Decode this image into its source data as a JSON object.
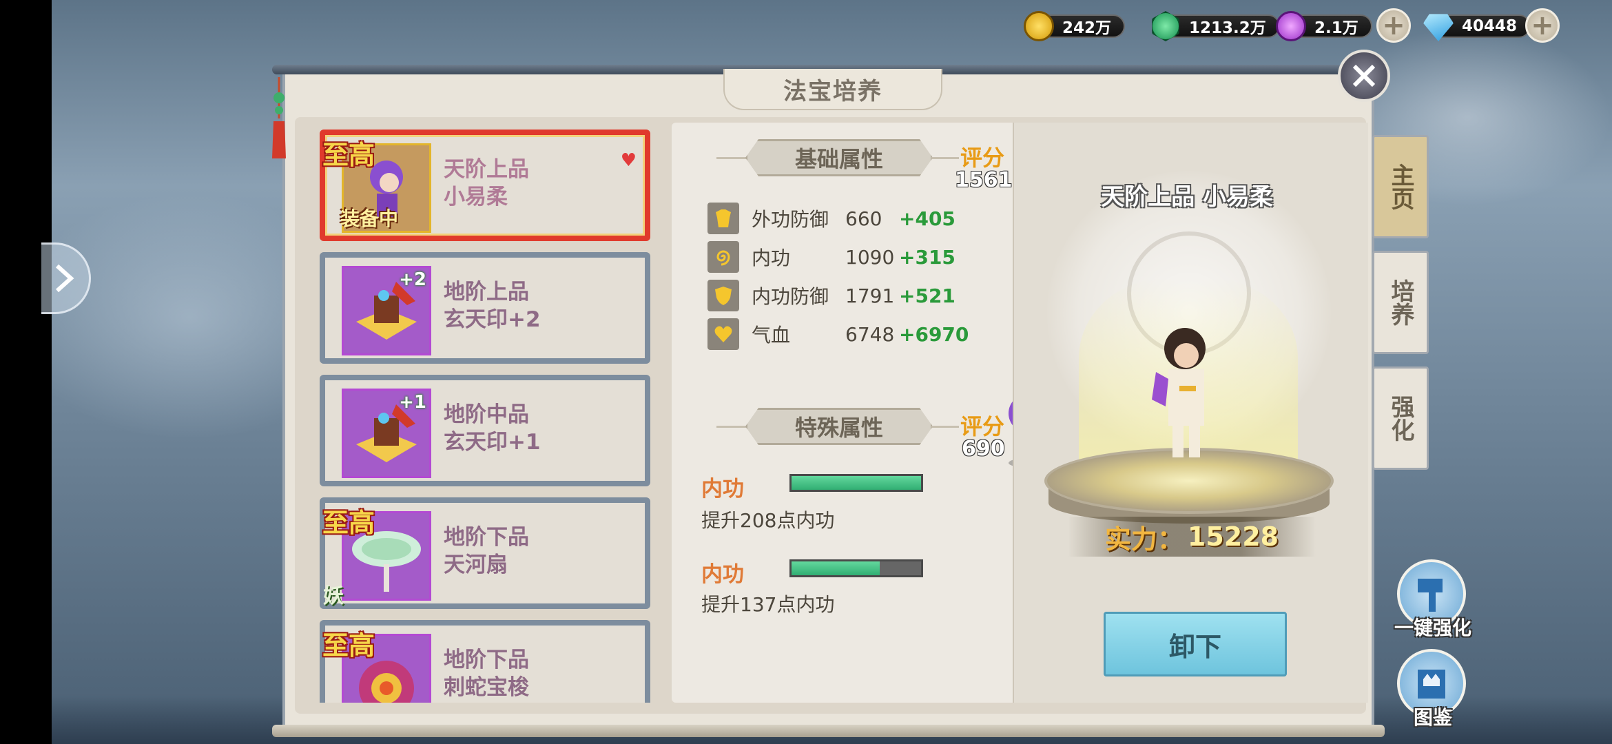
{
  "resources": [
    {
      "name": "gold",
      "value": "242万",
      "color": "#f2c81a",
      "icon": "gold-coin-icon"
    },
    {
      "name": "jade",
      "value": "1213.2万",
      "color": "#29b26a",
      "icon": "jade-gem-icon"
    },
    {
      "name": "spirit",
      "value": "2.1万",
      "color": "#b04ad8",
      "icon": "spirit-orb-icon"
    },
    {
      "name": "diamond",
      "value": "40448",
      "color": "#44b6f0",
      "icon": "diamond-icon"
    }
  ],
  "window": {
    "title": "法宝培养"
  },
  "items": [
    {
      "badge": "至高",
      "grade": "天阶上品",
      "name": "小易柔",
      "tag": "装备中",
      "plus": "",
      "selected": true
    },
    {
      "badge": "",
      "grade": "地阶上品",
      "name": "玄天印+2",
      "tag": "",
      "plus": "+2",
      "selected": false
    },
    {
      "badge": "",
      "grade": "地阶中品",
      "name": "玄天印+1",
      "tag": "",
      "plus": "+1",
      "selected": false
    },
    {
      "badge": "至高",
      "grade": "地阶下品",
      "name": "天河扇",
      "tag": "",
      "plus": "",
      "yao": "妖",
      "selected": false
    },
    {
      "badge": "至高",
      "grade": "地阶下品",
      "name": "刺蛇宝梭",
      "tag": "",
      "plus": "",
      "selected": false
    }
  ],
  "basic": {
    "header": "基础属性",
    "score_label": "评分",
    "score": "1561",
    "stats": [
      {
        "name": "外功防御",
        "value": "660",
        "add": "+405",
        "icon": "armor-icon"
      },
      {
        "name": "内功",
        "value": "1090",
        "add": "+315",
        "icon": "spiral-icon"
      },
      {
        "name": "内功防御",
        "value": "1791",
        "add": "+521",
        "icon": "shield-icon"
      },
      {
        "name": "气血",
        "value": "6748",
        "add": "+6970",
        "icon": "heart-icon"
      }
    ]
  },
  "special": {
    "header": "特殊属性",
    "score_label": "评分",
    "score": "690",
    "entries": [
      {
        "name": "内功",
        "fill": 1.0,
        "desc": "提升208点内功"
      },
      {
        "name": "内功",
        "fill": 0.68,
        "desc": "提升137点内功"
      }
    ]
  },
  "preview": {
    "title": "天阶上品 小易柔",
    "power_label": "实力：",
    "power_value": "15228",
    "unequip_label": "卸下"
  },
  "tabs": [
    {
      "label": "主页",
      "active": true
    },
    {
      "label": "培养",
      "active": false
    },
    {
      "label": "强化",
      "active": false
    }
  ],
  "actions": {
    "one_key_strengthen": "一键强化",
    "codex": "图鉴"
  }
}
